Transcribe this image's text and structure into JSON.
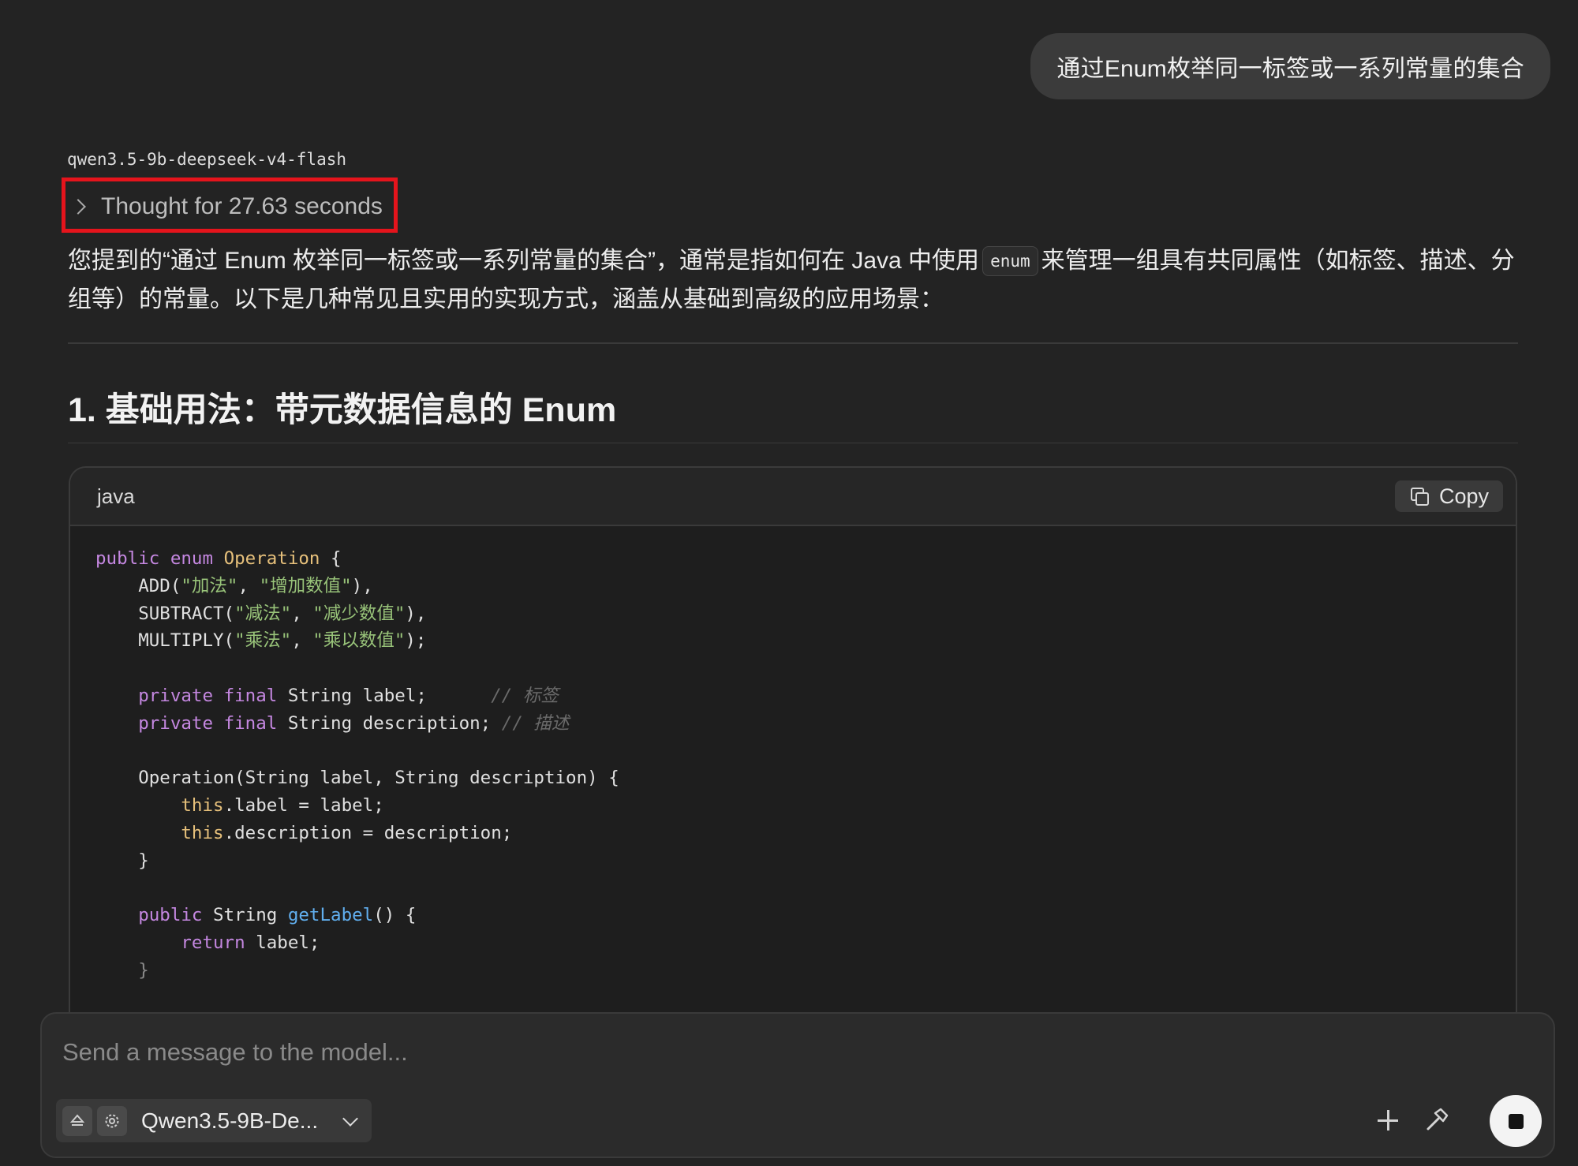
{
  "user_message": "通过Enum枚举同一标签或一系列常量的集合",
  "assistant": {
    "model_name": "qwen3.5-9b-deepseek-v4-flash",
    "thought_label": "Thought for 27.63 seconds",
    "intro": {
      "part1": "您提到的“通过 Enum 枚举同一标签或一系列常量的集合”，通常是指如何在 Java 中使用",
      "inline_code": "enum",
      "part2": "来管理一组具有共同属性（如标签、描述、分组等）的常量。以下是几种常见且实用的实现方式，涵盖从基础到高级的应用场景："
    },
    "section_heading": "1. 基础用法：带元数据信息的 Enum",
    "code_block": {
      "language": "java",
      "copy_label": "Copy",
      "lines": {
        "l1": [
          "public",
          "enum",
          "Operation",
          "{"
        ],
        "l2": [
          "ADD(",
          "\"加法\"",
          ", ",
          "\"增加数值\"",
          "),"
        ],
        "l3": [
          "SUBTRACT(",
          "\"减法\"",
          ", ",
          "\"减少数值\"",
          "),"
        ],
        "l4": [
          "MULTIPLY(",
          "\"乘法\"",
          ", ",
          "\"乘以数值\"",
          ");"
        ],
        "l5": [
          "private",
          "final",
          "String label;",
          "// 标签"
        ],
        "l6": [
          "private",
          "final",
          "String description;",
          "// 描述"
        ],
        "l7": [
          "Operation(String label, String description) {"
        ],
        "l8": [
          "this",
          ".label = label;"
        ],
        "l9": [
          "this",
          ".description = description;"
        ],
        "l10": [
          "}"
        ],
        "l11": [
          "public",
          "String",
          "getLabel",
          "() {"
        ],
        "l12": [
          "return",
          "label;"
        ],
        "l13": [
          "}"
        ]
      }
    }
  },
  "composer": {
    "placeholder": "Send a message to the model...",
    "model_selector_label": "Qwen3.5-9B-De..."
  },
  "colors": {
    "background": "#232323",
    "highlight_border": "#e5141c",
    "keyword": "#c487e0",
    "type": "#e6c07b",
    "string": "#98c379",
    "function": "#61afef",
    "comment": "#6a6a6a"
  },
  "icons": [
    "chevron-right-icon",
    "copy-icon",
    "eject-icon",
    "gear-icon",
    "chevron-down-icon",
    "plus-icon",
    "hammer-icon",
    "stop-icon"
  ]
}
